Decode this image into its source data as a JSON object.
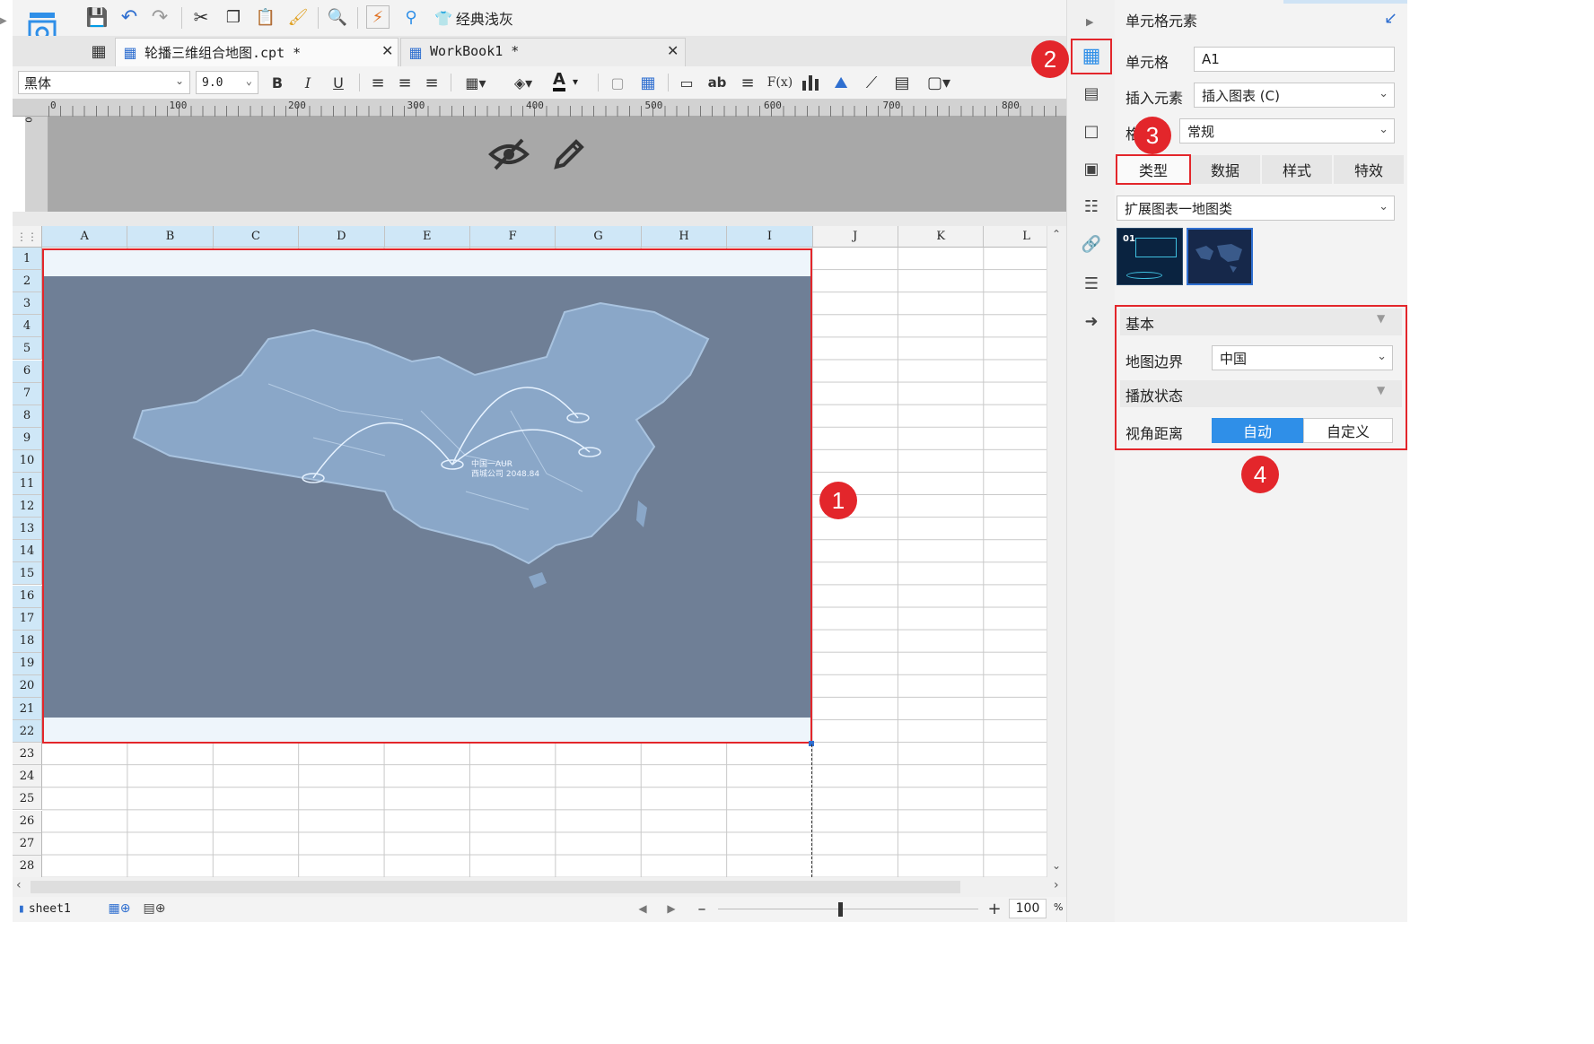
{
  "toolbar": {
    "theme_label": "经典浅灰",
    "font_name": "黑体",
    "font_size": "9.0",
    "bold": "B",
    "italic": "I",
    "underline": "U",
    "ab": "ab",
    "fx": "F(x)"
  },
  "tabs": [
    {
      "label": "轮播三维组合地图.cpt *"
    },
    {
      "label": "WorkBook1 *"
    }
  ],
  "ruler": {
    "marks": [
      "0",
      "100",
      "200",
      "300",
      "400",
      "500",
      "600",
      "700",
      "800"
    ]
  },
  "columns": [
    "A",
    "B",
    "C",
    "D",
    "E",
    "F",
    "G",
    "H",
    "I",
    "J",
    "K",
    "L"
  ],
  "rows": [
    "1",
    "2",
    "3",
    "4",
    "5",
    "6",
    "7",
    "8",
    "9",
    "10",
    "11",
    "12",
    "13",
    "14",
    "15",
    "16",
    "17",
    "18",
    "19",
    "20",
    "21",
    "22",
    "23",
    "24",
    "25",
    "26",
    "27",
    "28"
  ],
  "map_chart": {
    "label_line1": "中国一AUR",
    "label_line2": "西城公司 2048.84"
  },
  "status": {
    "sheet": "sheet1",
    "zoom": "100",
    "zoom_unit": "%"
  },
  "badges": [
    "1",
    "2",
    "3",
    "4"
  ],
  "panel": {
    "title": "单元格元素",
    "cell_label": "单元格",
    "cell_value": "A1",
    "insert_label": "插入元素",
    "insert_value": "插入图表 (C)",
    "format_label": "格",
    "format_value": "常规",
    "tabs": [
      "类型",
      "数据",
      "样式",
      "特效"
    ],
    "chart_category": "扩展图表一地图类",
    "thumb1_text": "01",
    "basic_header": "基本",
    "boundary_label": "地图边界",
    "boundary_value": "中国",
    "play_header": "播放状态",
    "view_label": "视角距离",
    "view_auto": "自动",
    "view_custom": "自定义"
  },
  "colors": {
    "accent": "#2f8fe8",
    "badge": "#e3262b",
    "map_bg": "#6f7f96",
    "header_blue": "#cfe7f7"
  }
}
